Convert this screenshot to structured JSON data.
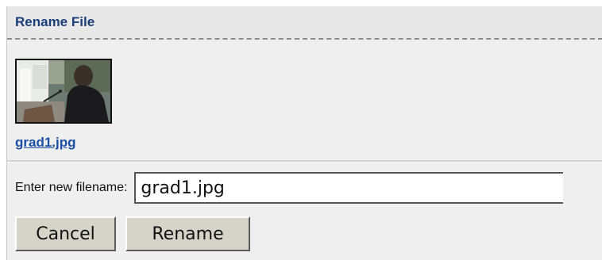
{
  "dialog": {
    "title": "Rename File"
  },
  "file": {
    "name": "grad1.jpg",
    "thumbnail_icon": "image-thumbnail"
  },
  "form": {
    "label": "Enter new filename:",
    "value": "grad1.jpg"
  },
  "actions": {
    "cancel_label": "Cancel",
    "rename_label": "Rename"
  },
  "colors": {
    "title": "#1c3f7a",
    "link": "#1a4fa3",
    "panel_bg": "#efefef",
    "button_bg": "#d6d3c8"
  }
}
